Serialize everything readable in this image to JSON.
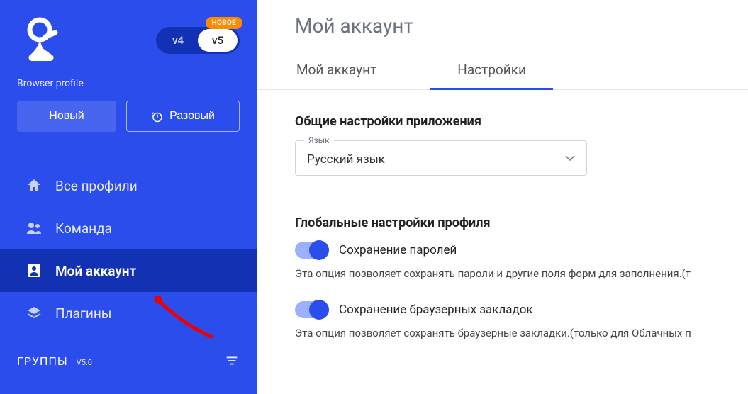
{
  "sidebar": {
    "version_badge": "НОВОЕ",
    "version_v4": "v4",
    "version_v5": "v5",
    "profile_label": "Browser profile",
    "btn_new": "Новый",
    "btn_onetime": "Разовый",
    "nav": [
      {
        "label": "Все профили"
      },
      {
        "label": "Команда"
      },
      {
        "label": "Мой аккаунт"
      },
      {
        "label": "Плагины"
      }
    ],
    "groups_title": "ГРУППЫ",
    "groups_version": "V5.0"
  },
  "main": {
    "title": "Мой аккаунт",
    "tabs": [
      {
        "label": "Мой аккаунт"
      },
      {
        "label": "Настройки"
      }
    ],
    "general_settings_title": "Общие настройки приложения",
    "language_label": "Язык",
    "language_value": "Русский язык",
    "global_profile_title": "Глобальные настройки профиля",
    "toggle1_label": "Сохранение паролей",
    "toggle1_desc": "Эта опция позволяет сохранять пароли и другие поля форм для заполнения.(т",
    "toggle2_label": "Сохранение браузерных закладок",
    "toggle2_desc": "Эта опция позволяет сохранять браузерные закладки.(только для Облачных п"
  }
}
